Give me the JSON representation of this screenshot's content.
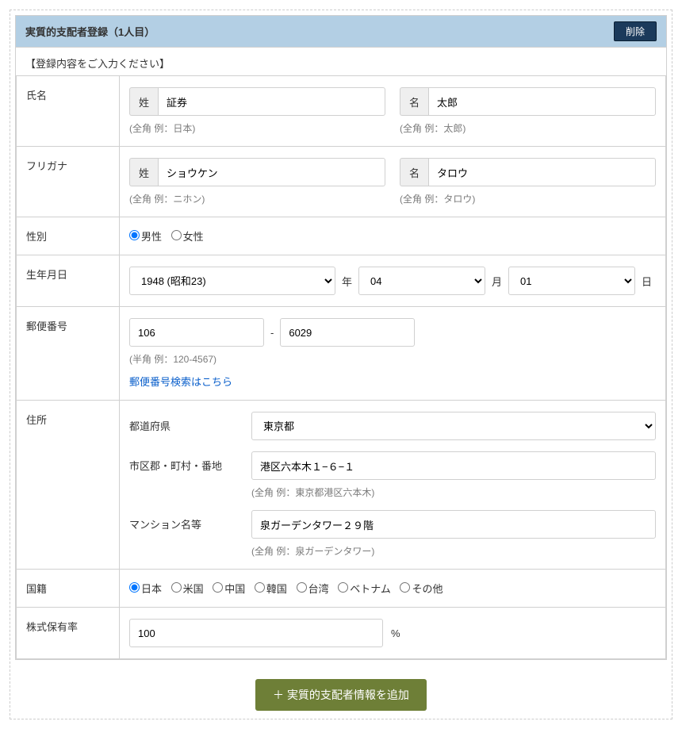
{
  "header": {
    "title": "実質的支配者登録（1人目）",
    "delete_btn": "削除"
  },
  "instruction": "【登録内容をご入力ください】",
  "fields": {
    "name_label": "氏名",
    "name_sei_prefix": "姓",
    "name_sei_value": "証券",
    "name_sei_hint": "(全角 例：日本)",
    "name_mei_prefix": "名",
    "name_mei_value": "太郎",
    "name_mei_hint": "(全角 例：太郎)",
    "kana_label": "フリガナ",
    "kana_sei_prefix": "姓",
    "kana_sei_value": "ショウケン",
    "kana_sei_hint": "(全角 例：ニホン)",
    "kana_mei_prefix": "名",
    "kana_mei_value": "タロウ",
    "kana_mei_hint": "(全角 例：タロウ)",
    "gender_label": "性別",
    "gender_male": "男性",
    "gender_female": "女性",
    "dob_label": "生年月日",
    "dob_year_value": "1948 (昭和23)",
    "dob_year_unit": "年",
    "dob_month_value": "04",
    "dob_month_unit": "月",
    "dob_day_value": "01",
    "dob_day_unit": "日",
    "postal_label": "郵便番号",
    "postal_first": "106",
    "postal_sep": "-",
    "postal_second": "6029",
    "postal_hint": "(半角 例：120-4567)",
    "postal_link": "郵便番号検索はこちら",
    "address_label": "住所",
    "pref_label": "都道府県",
    "pref_value": "東京都",
    "city_label": "市区郡・町村・番地",
    "city_value": "港区六本木１−６−１",
    "city_hint": "(全角 例：東京都港区六本木)",
    "bldg_label": "マンション名等",
    "bldg_value": "泉ガーデンタワー２９階",
    "bldg_hint": "(全角 例：泉ガーデンタワー)",
    "nation_label": "国籍",
    "nat_jp": "日本",
    "nat_us": "米国",
    "nat_cn": "中国",
    "nat_kr": "韓国",
    "nat_tw": "台湾",
    "nat_vn": "ベトナム",
    "nat_other": "その他",
    "share_label": "株式保有率",
    "share_value": "100",
    "share_unit": "%"
  },
  "footer": {
    "add_btn_icon": "＋",
    "add_btn_text": "実質的支配者情報を追加"
  }
}
